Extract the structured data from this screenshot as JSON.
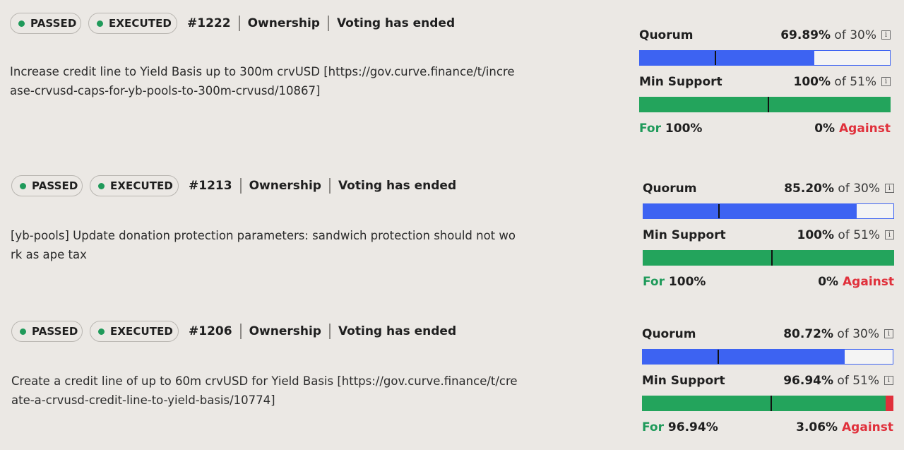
{
  "proposals": [
    {
      "status": "PASSED",
      "execution": "EXECUTED",
      "id": "#1222",
      "type": "Ownership",
      "state": "Voting has ended",
      "title": "Increase credit line to Yield Basis up to 300m crvUSD [https://gov.curve.finance/t/increase-crvusd-caps-for-yb-pools-to-300m-crvusd/10867]",
      "quorum": {
        "label": "Quorum",
        "value": "69.89%",
        "of": "of 30%",
        "fill_pct": 69.89,
        "threshold_pct": 30
      },
      "support": {
        "label": "Min Support",
        "value": "100%",
        "of": "of 51%",
        "for_pct": 100,
        "threshold_pct": 51
      },
      "votes": {
        "for_word": "For",
        "for_value": "100%",
        "against_value": "0%",
        "against_word": "Against"
      }
    },
    {
      "status": "PASSED",
      "execution": "EXECUTED",
      "id": "#1213",
      "type": "Ownership",
      "state": "Voting has ended",
      "title": "[yb-pools] Update donation protection parameters: sandwich protection should not work as ape tax",
      "quorum": {
        "label": "Quorum",
        "value": "85.20%",
        "of": "of 30%",
        "fill_pct": 85.2,
        "threshold_pct": 30
      },
      "support": {
        "label": "Min Support",
        "value": "100%",
        "of": "of 51%",
        "for_pct": 100,
        "threshold_pct": 51
      },
      "votes": {
        "for_word": "For",
        "for_value": "100%",
        "against_value": "0%",
        "against_word": "Against"
      }
    },
    {
      "status": "PASSED",
      "execution": "EXECUTED",
      "id": "#1206",
      "type": "Ownership",
      "state": "Voting has ended",
      "title": "Create a credit line of up to 60m crvUSD for Yield Basis [https://gov.curve.finance/t/create-a-crvusd-credit-line-to-yield-basis/10774]",
      "quorum": {
        "label": "Quorum",
        "value": "80.72%",
        "of": "of 30%",
        "fill_pct": 80.72,
        "threshold_pct": 30
      },
      "support": {
        "label": "Min Support",
        "value": "96.94%",
        "of": "of 51%",
        "for_pct": 96.94,
        "threshold_pct": 51
      },
      "votes": {
        "for_word": "For",
        "for_value": "96.94%",
        "against_value": "3.06%",
        "against_word": "Against"
      }
    }
  ],
  "icons": {
    "info": "info-icon",
    "status_dot": "status-dot-icon"
  },
  "colors": {
    "quorum": "#3d63f2",
    "for": "#23a45c",
    "against": "#e0303b",
    "background": "#ebe8e4"
  }
}
